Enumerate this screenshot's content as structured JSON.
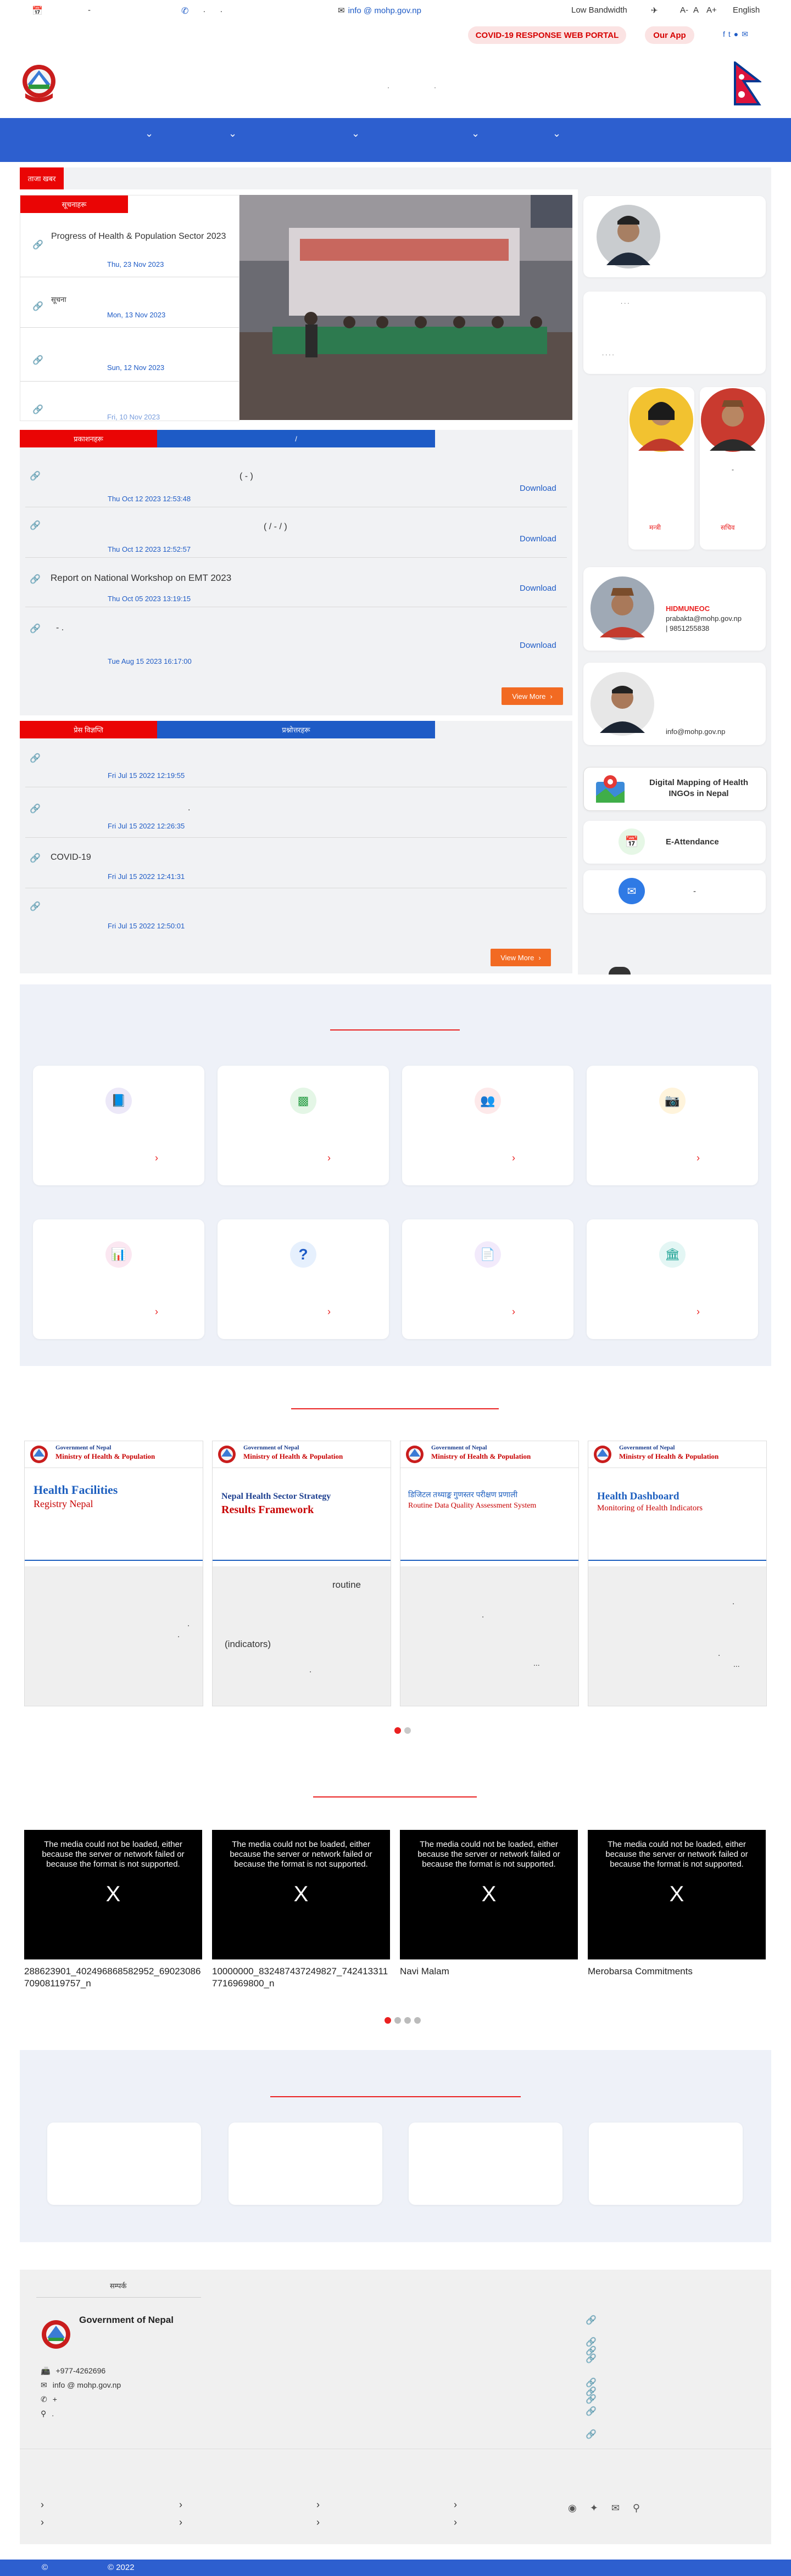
{
  "topbar": {
    "email": "info @ mohp.gov.np",
    "low_bandwidth": "Low Bandwidth",
    "font_minus": "A-",
    "font_normal": "A",
    "font_plus": "A+",
    "language": "English",
    "covid_portal": "COVID-19 RESPONSE WEB PORTAL",
    "our_app": "Our App"
  },
  "news": {
    "tab_label": "सूचनाहरू",
    "items": [
      {
        "title": "Progress of Health & Population Sector 2023",
        "date": "Thu, 23 Nov 2023"
      },
      {
        "title": "सूचना",
        "date": "Mon, 13 Nov 2023"
      },
      {
        "title": "",
        "date": "Sun, 12 Nov 2023"
      },
      {
        "title": "",
        "date": "Fri, 10 Nov 2023"
      }
    ]
  },
  "publications": {
    "tab_active": "प्रकाशनहरू",
    "tab_other": "/",
    "items": [
      {
        "title": "(          -          )",
        "date": "Thu Oct 12 2023 12:53:48",
        "download": "Download"
      },
      {
        "title": "(     /     -     /     )",
        "date": "Thu Oct 12 2023 12:52:57",
        "download": "Download"
      },
      {
        "title": "Report on National Workshop on EMT 2023",
        "date": "Thu Oct 05 2023 13:19:15",
        "download": "Download"
      },
      {
        "title": "-     .",
        "date": "Tue Aug 15 2023 16:17:00",
        "download": "Download"
      }
    ],
    "view_more": "View More"
  },
  "press": {
    "tab_active": "प्रेस विज्ञप्ति",
    "tab_other": "प्रश्नोत्तरहरू",
    "items": [
      {
        "title": "",
        "date": "Fri Jul 15 2022 12:19:55"
      },
      {
        "title": ".",
        "date": "Fri Jul 15 2022 12:26:35"
      },
      {
        "title": "COVID-19",
        "date": "Fri Jul 15 2022 12:41:31"
      },
      {
        "title": "",
        "date": "Fri Jul 15 2022 12:50:01"
      }
    ],
    "view_more": "View More"
  },
  "officials": {
    "info_officer_label": "HIDMUNEOC",
    "info_officer_email": "prabakta@mohp.gov.np",
    "info_officer_phone": "| 9851255838",
    "spokes_email": "info@mohp.gov.np",
    "badge_left": "मन्त्री",
    "badge_right": "सचिव"
  },
  "sidebar_links": [
    {
      "label": "Digital Mapping of Health INGOs in Nepal",
      "icon": "map-icon"
    },
    {
      "label": "E-Attendance",
      "icon": "calendar-check-icon"
    },
    {
      "label": "-",
      "icon": "mail-icon"
    }
  ],
  "portals": [
    {
      "govt": "Government of Nepal",
      "ministry": "Ministry of Health & Population",
      "title1": "Health Facilities",
      "title2": "Registry Nepal",
      "desc1": "",
      "desc2": ".",
      "desc3": "."
    },
    {
      "govt": "Government of Nepal",
      "ministry": "Ministry of Health & Population",
      "title1": "Nepal Health Sector Strategy",
      "title2": "Results Framework",
      "desc1": "routine",
      "desc2": "(indicators)",
      "desc3": "."
    },
    {
      "govt": "Government of Nepal",
      "ministry": "Ministry of Health & Population",
      "title1": "डिजिटल तथ्याङ्क गुणस्तर परीक्षण प्रणाली",
      "title2": "Routine Data Quality Assessment System",
      "desc1": ".",
      "desc2": "...",
      "desc3": ""
    },
    {
      "govt": "Government of Nepal",
      "ministry": "Ministry of Health & Population",
      "title1": "Health Dashboard",
      "title2": "Monitoring of Health Indicators",
      "desc1": ".",
      "desc2": ".",
      "desc3": "..."
    }
  ],
  "videos": {
    "error_msg": "The media could not be loaded, either because the server or network failed or because the format is not supported.",
    "close": "X",
    "items": [
      {
        "title": "288623901_402496868582952_6902308670908119757_n"
      },
      {
        "title": "10000000_832487437249827_7424133117716969800_n"
      },
      {
        "title": "Navi Malam"
      },
      {
        "title": "Merobarsa Commitments"
      }
    ]
  },
  "footer": {
    "heading": "सम्पर्क",
    "org": "Government of Nepal",
    "phone": "+977-4262696",
    "email": "info @ mohp.gov.np",
    "fax": "+",
    "address": ".",
    "copyright_symbol": "©",
    "year": "© 2022"
  },
  "colors": {
    "primary_blue": "#2d5fcf",
    "red": "#ea0505",
    "orange": "#f26a22"
  }
}
